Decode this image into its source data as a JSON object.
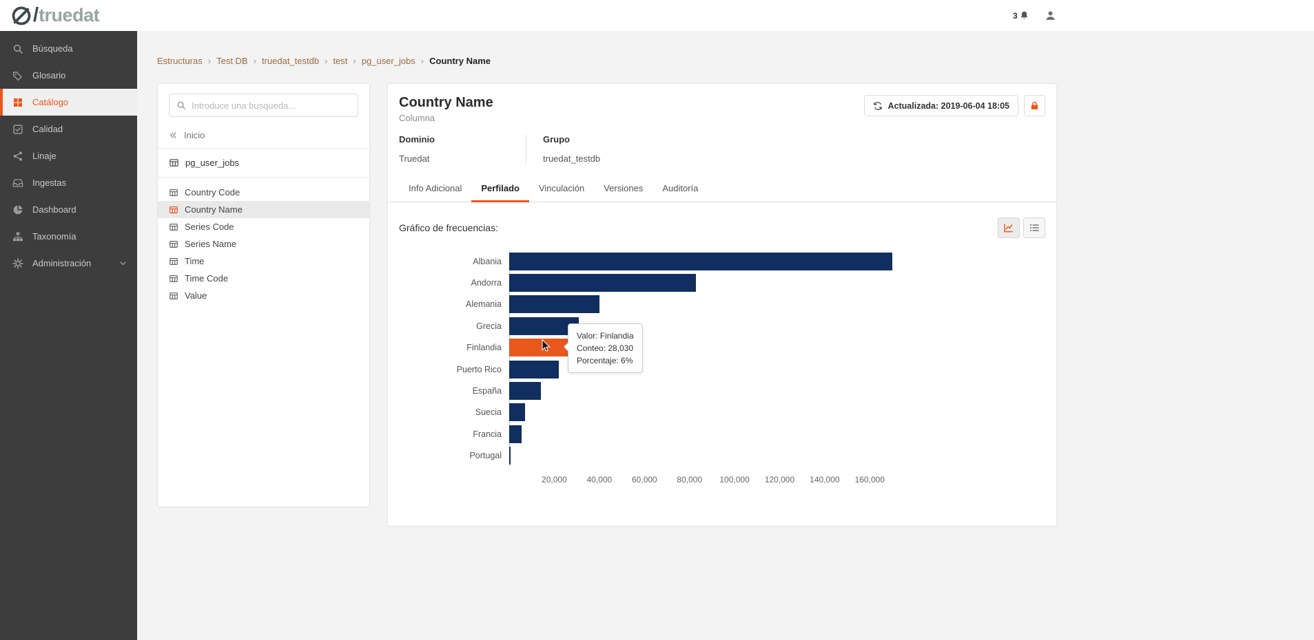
{
  "header": {
    "logo_slash": "/",
    "logo_text": "truedat",
    "notification_count": "3"
  },
  "sidebar": {
    "items": [
      {
        "label": "Búsqueda",
        "icon": "search",
        "active": false
      },
      {
        "label": "Glosario",
        "icon": "tags",
        "active": false
      },
      {
        "label": "Catálogo",
        "icon": "grid",
        "active": true
      },
      {
        "label": "Calidad",
        "icon": "check",
        "active": false
      },
      {
        "label": "Linaje",
        "icon": "share",
        "active": false
      },
      {
        "label": "Ingestas",
        "icon": "inbox",
        "active": false
      },
      {
        "label": "Dashboard",
        "icon": "pie",
        "active": false
      },
      {
        "label": "Taxonomía",
        "icon": "sitemap",
        "active": false
      },
      {
        "label": "Administración",
        "icon": "gear",
        "active": false,
        "has_chevron": true
      }
    ]
  },
  "breadcrumb": {
    "links": [
      "Estructuras",
      "Test DB",
      "truedat_testdb",
      "test",
      "pg_user_jobs"
    ],
    "current": "Country Name",
    "separator": "›"
  },
  "structure_panel": {
    "search_placeholder": "Introduce una busqueda...",
    "back_label": "Inicio",
    "parent_item": "pg_user_jobs",
    "columns": [
      "Country Code",
      "Country Name",
      "Series Code",
      "Series Name",
      "Time",
      "Time Code",
      "Value"
    ],
    "selected_column": "Country Name"
  },
  "detail": {
    "title": "Country Name",
    "subtitle": "Columna",
    "updated_label": "Actualizada: 2019-06-04 18:05",
    "fields": [
      {
        "label": "Dominio",
        "value": "Truedat"
      },
      {
        "label": "Grupo",
        "value": "truedat_testdb"
      }
    ],
    "tabs": [
      "Info Adicional",
      "Perfilado",
      "Vinculación",
      "Versiones",
      "Auditoría"
    ],
    "active_tab": "Perfilado",
    "chart_label": "Gráfico de frecuencias:",
    "views": [
      "chart",
      "list"
    ],
    "active_view": "chart"
  },
  "chart_tooltip": {
    "lines": [
      "Valor: Finlandia",
      "Conteo: 28,030",
      "Porcentaje: 6%"
    ]
  },
  "chart_data": {
    "type": "bar",
    "orientation": "horizontal",
    "title": "Gráfico de frecuencias",
    "categories": [
      "Albania",
      "Andorra",
      "Alemania",
      "Grecia",
      "Finlandia",
      "Puerto Rico",
      "España",
      "Suecia",
      "Francia",
      "Portugal"
    ],
    "values": [
      170000,
      83000,
      40000,
      31000,
      28030,
      22000,
      14000,
      7000,
      5500,
      600
    ],
    "highlighted_category": "Finlandia",
    "highlighted_value": 28030,
    "highlighted_percentage": "6%",
    "xlim": [
      0,
      170000
    ],
    "x_ticks": [
      {
        "value": 20000,
        "label": "20,000"
      },
      {
        "value": 40000,
        "label": "40,000"
      },
      {
        "value": 60000,
        "label": "60,000"
      },
      {
        "value": 80000,
        "label": "80,000"
      },
      {
        "value": 100000,
        "label": "100,000"
      },
      {
        "value": 120000,
        "label": "120,000"
      },
      {
        "value": 140000,
        "label": "140,000"
      },
      {
        "value": 160000,
        "label": "160,000"
      }
    ],
    "bar_color": "#102e60",
    "highlight_color": "#e8571c",
    "legend": false,
    "grid": false
  },
  "colors": {
    "accent": "#e8571c",
    "bar": "#102e60",
    "sidebar_bg": "#3d3d3d",
    "breadcrumb_link": "#a06a3f"
  }
}
